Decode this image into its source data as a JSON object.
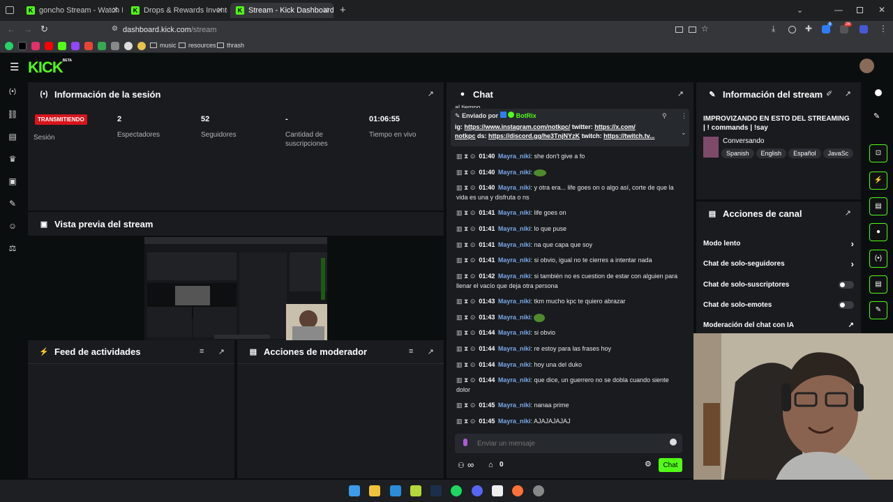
{
  "browser": {
    "tabs": [
      {
        "title": "goncho Stream - Watch Live on",
        "close": "✕"
      },
      {
        "title": "Drops & Rewards Inventory - K",
        "close": "✕"
      },
      {
        "title": "Stream - Kick Dashboard",
        "close": "✕"
      }
    ],
    "new_tab": "+",
    "url_host": "dashboard.kick.com",
    "url_path": "/stream",
    "bookmarks": [
      "music",
      "resources",
      "thrash"
    ],
    "badge_counts": [
      "9",
      "26"
    ]
  },
  "app": {
    "logo": "KICK",
    "logo_beta": "BETA"
  },
  "session": {
    "title": "Información de la sesión",
    "live_badge": "TRANSMITIENDO",
    "session_label": "Sesión",
    "viewers_value": "2",
    "viewers_label": "Espectadores",
    "followers_value": "52",
    "followers_label": "Seguidores",
    "subs_value": "-",
    "subs_label": "Cantidad de suscripciones",
    "uptime_value": "01:06:55",
    "uptime_label": "Tiempo en vivo"
  },
  "preview": {
    "title": "Vista previa del stream"
  },
  "activity": {
    "title": "Feed de actividades"
  },
  "modactions": {
    "title": "Acciones de moderador"
  },
  "chat": {
    "title": "Chat",
    "cut_top": "al tiempo",
    "pinned_by_label": "Enviado por",
    "pinned_by_user": "BotRix",
    "pinned_prefix_ig": "ig:",
    "pinned_link_ig": "https://www.instagram.com/notkpc/",
    "pinned_prefix_tw": "twitter:",
    "pinned_link_x": "https://x.com/",
    "pinned_x_tail": "notkpc",
    "pinned_prefix_ds": "ds:",
    "pinned_link_ds": "https://discord.gg/he3TnjNYzK",
    "pinned_prefix_twitch": "twitch:",
    "pinned_link_twitch": "https://twitch.tv...",
    "messages": [
      {
        "time": "01:40",
        "user": "Mayra_niki",
        "text": "she don't give a fo"
      },
      {
        "time": "01:40",
        "user": "Mayra_niki",
        "text": ""
      },
      {
        "time": "01:40",
        "user": "Mayra_niki",
        "text": "y otra era... life goes on o algo así, corte de que la vida es una y disfruta o ns"
      },
      {
        "time": "01:41",
        "user": "Mayra_niki",
        "text": "life goes on"
      },
      {
        "time": "01:41",
        "user": "Mayra_niki",
        "text": "lo que puse"
      },
      {
        "time": "01:41",
        "user": "Mayra_niki",
        "text": "na que capa que soy"
      },
      {
        "time": "01:41",
        "user": "Mayra_niki",
        "text": "si obvio, igual no te cierres a intentar nada"
      },
      {
        "time": "01:42",
        "user": "Mayra_niki",
        "text": "si también no es cuestion de estar con alguien para llenar el vacío que deja otra persona"
      },
      {
        "time": "01:43",
        "user": "Mayra_niki",
        "text": "tkm mucho kpc te quiero abrazar"
      },
      {
        "time": "01:43",
        "user": "Mayra_niki",
        "text": ""
      },
      {
        "time": "01:44",
        "user": "Mayra_niki",
        "text": "si obvio"
      },
      {
        "time": "01:44",
        "user": "Mayra_niki",
        "text": "re estoy para las frases hoy"
      },
      {
        "time": "01:44",
        "user": "Mayra_niki",
        "text": "hoy una del duko"
      },
      {
        "time": "01:44",
        "user": "Mayra_niki",
        "text": "que dice, un guerrero no se dobla cuando siente dolor"
      },
      {
        "time": "01:45",
        "user": "Mayra_niki",
        "text": "nanaa prime"
      },
      {
        "time": "01:45",
        "user": "Mayra_niki",
        "text": "AJAJAJAJAJ"
      }
    ],
    "input_placeholder": "Enviar un mensaje",
    "infinity": "∞",
    "store_count": "0",
    "send_label": "Chat"
  },
  "stream_info": {
    "title": "Información del stream",
    "stream_title": "IMPROVIZANDO EN ESTO DEL STREAMING | ! commands | !say",
    "category": "Conversando",
    "tags": [
      "Spanish",
      "English",
      "Español",
      "JavaSc"
    ]
  },
  "channel_actions": {
    "title": "Acciones de canal",
    "slow": "Modo lento",
    "followers_only": "Chat de solo-seguidores",
    "subs_only": "Chat de solo-suscriptores",
    "emotes_only": "Chat de solo-emotes",
    "ai_mod": "Moderación del chat con IA"
  },
  "colors": {
    "accent": "#53fc18",
    "live": "#d6161d",
    "username": "#7aa7e6",
    "panel": "#191b1f"
  }
}
